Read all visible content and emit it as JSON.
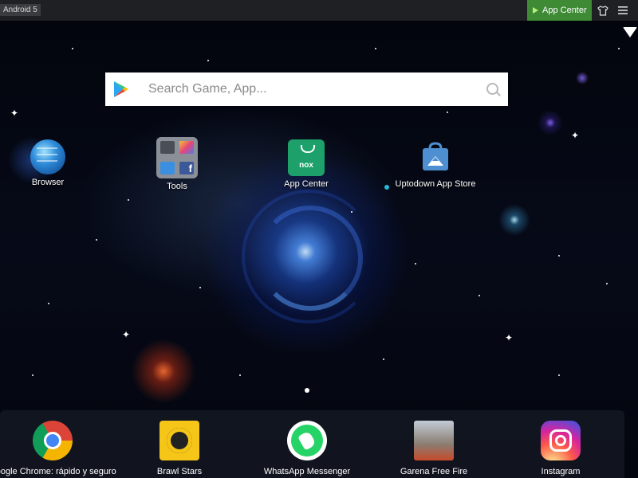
{
  "titlebar": {
    "title": "Android 5",
    "app_center_label": "App Center",
    "icons": [
      "play-icon",
      "shirt-icon",
      "menu-icon"
    ],
    "accent_color": "#3e8a35"
  },
  "status": {
    "wifi_icon": "wifi-icon"
  },
  "search": {
    "placeholder": "Search Game, App...",
    "icons": [
      "google-play-icon",
      "search-icon"
    ]
  },
  "desktop": {
    "items": [
      {
        "label": "Browser",
        "icon": "globe-icon"
      },
      {
        "label": "Tools",
        "icon": "tools-folder-icon"
      },
      {
        "label": "App Center",
        "icon": "nox-app-center-icon"
      },
      {
        "label": "Uptodown App Store",
        "icon": "uptodown-icon",
        "badge": "new-dot"
      }
    ],
    "tools_folder_icons": [
      "camera-icon",
      "gallery-icon",
      "folder-icon",
      "facebook-icon"
    ],
    "nox_label": "nox"
  },
  "pager": {
    "active_page": 1
  },
  "dock": {
    "items": [
      {
        "label": "Google Chrome: rápido y seguro",
        "icon": "chrome-icon"
      },
      {
        "label": "Brawl Stars",
        "icon": "brawl-stars-icon"
      },
      {
        "label": "WhatsApp Messenger",
        "icon": "whatsapp-icon"
      },
      {
        "label": "Garena Free Fire",
        "icon": "free-fire-icon"
      },
      {
        "label": "Instagram",
        "icon": "instagram-icon"
      }
    ]
  }
}
